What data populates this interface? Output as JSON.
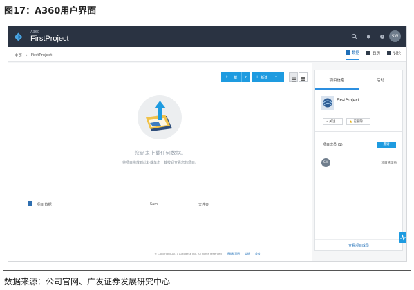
{
  "figure": {
    "title": "图17：A360用户界面",
    "source": "数据来源：公司官网、广发证券发展研究中心"
  },
  "header": {
    "app_small": "A360",
    "app_name": "FirstProject",
    "avatar": "SW"
  },
  "breadcrumb": {
    "home": "主页",
    "current": "FirstProject"
  },
  "views": [
    {
      "label": "数据",
      "icon": "folder-icon",
      "active": true
    },
    {
      "label": "日历",
      "icon": "calendar-icon",
      "active": false
    },
    {
      "label": "讨论",
      "icon": "chat-icon",
      "active": false
    }
  ],
  "toolbar": {
    "upload_label": "上载",
    "new_label": "新建"
  },
  "empty": {
    "title": "您尚未上载任何数据。",
    "hint": "将项目拖放到此处或单击上载按钮查看您的项目。"
  },
  "table": {
    "columns": [
      "项目 数据",
      "Sam",
      "文件夹"
    ]
  },
  "side_panel": {
    "tabs": [
      "项目信息",
      "活动"
    ],
    "project_name": "FirstProject",
    "chips": [
      "关注",
      "已删除"
    ],
    "members_label": "项目成员 (1)",
    "add_label": "邀请",
    "member_avatar": "SW",
    "member_role": "项目管理员",
    "view_all": "查看项目成员"
  },
  "footer": {
    "copyright": "© Copyright 2017 Autodesk Inc. All rights reserved",
    "links": [
      "隐私和声明",
      "商标",
      "条款"
    ]
  },
  "colors": {
    "topbar": "#2a3342",
    "accent": "#1e9be0"
  }
}
